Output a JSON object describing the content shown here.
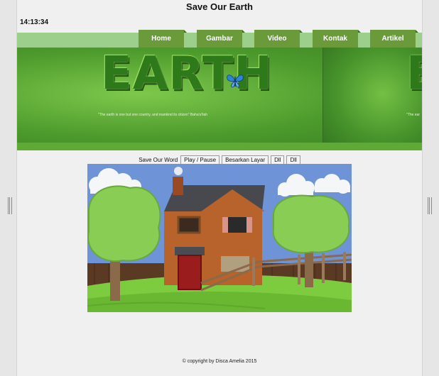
{
  "page": {
    "title": "Save Our Earth",
    "clock": "14:13:34"
  },
  "nav": {
    "items": [
      {
        "label": "Home"
      },
      {
        "label": "Gambar"
      },
      {
        "label": "Video"
      },
      {
        "label": "Kontak"
      },
      {
        "label": "Artikel"
      }
    ]
  },
  "banner": {
    "word": "EARTH",
    "word_partial": "E",
    "quote": "\"The earth is one but one country, and mankind its citizen\" Baha'u'llah",
    "quote_partial": "\"The ear",
    "image_description": "grass-textured EARTH lettering with blue butterfly"
  },
  "video": {
    "label": "Save Our Word",
    "buttons": [
      {
        "label": "Play / Pause"
      },
      {
        "label": "Besarkan Layar"
      },
      {
        "label": "Dll"
      },
      {
        "label": "Dll"
      }
    ]
  },
  "footer": {
    "text": "© copyright by Disca Amelia 2015"
  },
  "colors": {
    "nav_tab": "#6a9a3a",
    "nav_bar": "#9ccf8c",
    "page_bg": "#f0f0f0",
    "banner_green": "#4c9a2c",
    "sky": "#6e93d6"
  },
  "icons": {
    "splitter": "vertical-splitter-handle-icon",
    "butterfly": "butterfly-icon"
  }
}
